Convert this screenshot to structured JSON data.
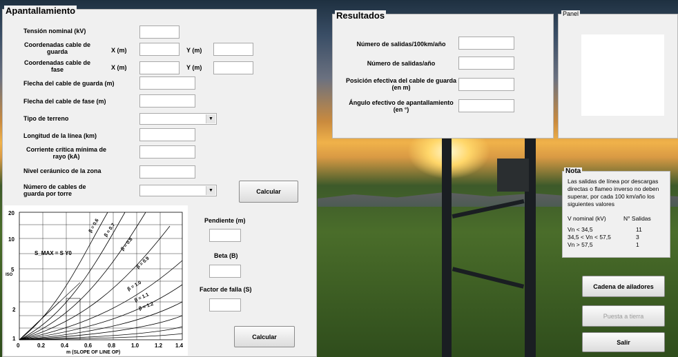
{
  "apantallamiento": {
    "title": "Apantallamiento",
    "tension_nominal": "Tensión nominal (kV)",
    "coord_guarda": "Coordenadas cable de guarda",
    "coord_fase": "Coordenadas cable de fase",
    "x_label": "X (m)",
    "y_label": "Y (m)",
    "flecha_guarda": "Flecha del cable de guarda (m)",
    "flecha_fase": "Flecha del cable de fase (m)",
    "tipo_terreno": "Tipo de terreno",
    "longitud_linea": "Longitud de la línea (km)",
    "corriente_critica": "Corriente crítica mínima de rayo (kA)",
    "nivel_ceraunico": "Nivel ceráunico de la zona",
    "num_cables": "Número de cables de guarda por torre",
    "calcular": "Calcular"
  },
  "graph": {
    "formula": "S_MAX = S Y0",
    "xlabel": "m (SLOPE OF LINE OP)",
    "ylabel": "ISO",
    "x_ticks": [
      "0",
      "0.2",
      "0.4",
      "0.6",
      "0.8",
      "1.0",
      "1.2",
      "1.4"
    ],
    "y_ticks": [
      "20",
      "10",
      "5",
      "2",
      "1"
    ],
    "beta_labels": [
      "β = 0.6",
      "β = 0.7",
      "β = 0.8",
      "β = 0.9",
      "β = 1.0",
      "β = 1.1",
      "β = 1.2"
    ]
  },
  "factor": {
    "pendiente": "Pendiente (m)",
    "beta": "Beta (B)",
    "factor_falla": "Factor de falla (S)",
    "calcular": "Calcular"
  },
  "resultados": {
    "title": "Resultados",
    "salidas_100km": "Número de salidas/100km/año",
    "salidas_ano": "Número de salidas/año",
    "posicion_efectiva": "Posición efectiva del cable de guarda (en m)",
    "angulo_efectivo": "Ángulo efectivo de apantallamiento (en °)"
  },
  "panel": {
    "title": "Panel"
  },
  "nota": {
    "title": "Nota",
    "text": "Las salidas de línea por descargas directas o flameo inverso no deben superar, por cada 100 km/año los siguientes valores",
    "col1": "V nominal (kV)",
    "col2": "N° Salidas",
    "rows": [
      {
        "v": "Vn < 34,5",
        "n": "11"
      },
      {
        "v": "34,5 < Vn < 57,5",
        "n": "3"
      },
      {
        "v": "Vn > 57,5",
        "n": "1"
      }
    ]
  },
  "buttons": {
    "cadena": "Cadena de ailadores",
    "puesta": "Puesta a tierra",
    "salir": "Salir"
  },
  "colors": {
    "panel_bg": "#f0f0f0",
    "disabled_text": "#9a9a9a"
  }
}
